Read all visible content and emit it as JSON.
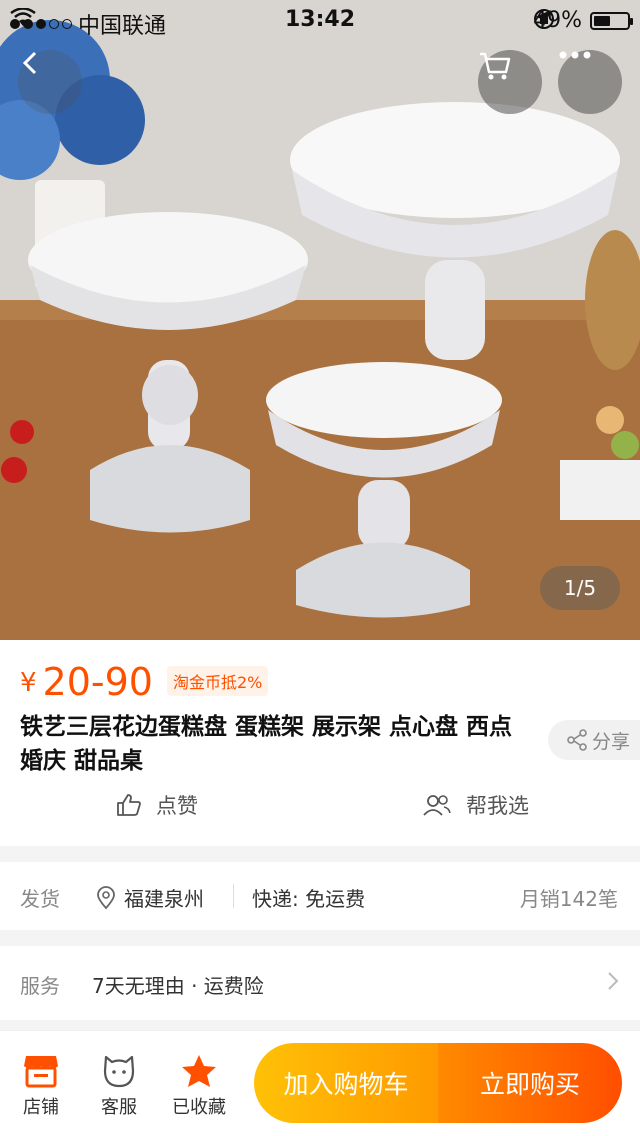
{
  "status_bar": {
    "carrier": "中国联通",
    "time": "13:42",
    "battery": "49%",
    "battery_level": 0.49
  },
  "gallery": {
    "indicator": "1/5",
    "cart_icon": "cart-icon",
    "more_icon": "more-icon",
    "back_icon": "back-icon"
  },
  "product": {
    "currency": "¥",
    "price": "20-90",
    "coin_badge": "淘金币抵2%",
    "title": "铁艺三层花边蛋糕盘 蛋糕架 展示架 点心盘 西点 婚庆 甜品桌",
    "share_label": "分享",
    "like_label": "点赞",
    "help_choose_label": "帮我选"
  },
  "delivery": {
    "label": "发货",
    "location": "福建泉州",
    "shipping": "快递: 免运费",
    "monthly_sales": "月销142笔"
  },
  "service": {
    "label": "服务",
    "value": "7天无理由 · 运费险"
  },
  "bottom_bar": {
    "store_label": "店铺",
    "service_label": "客服",
    "favorite_label": "已收藏",
    "add_to_cart_label": "加入购物车",
    "buy_now_label": "立即购买"
  },
  "colors": {
    "accent": "#ff5000",
    "cart_button": "#ffa800",
    "buy_button": "#ff5a00"
  }
}
